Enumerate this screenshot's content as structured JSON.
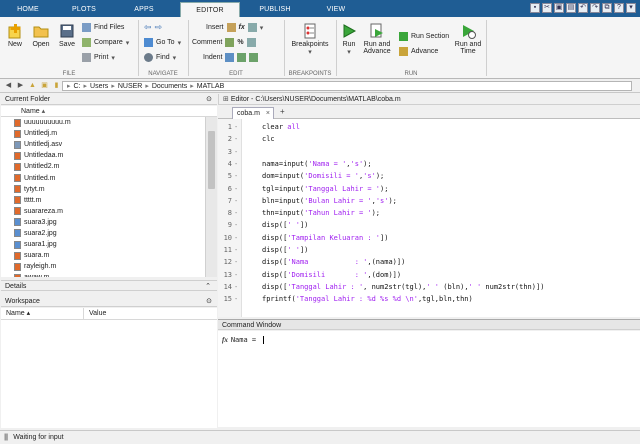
{
  "tabs": [
    "HOME",
    "PLOTS",
    "APPS",
    "EDITOR",
    "PUBLISH",
    "VIEW"
  ],
  "active_tab": "EDITOR",
  "ribbon": {
    "file": {
      "new": "New",
      "open": "Open",
      "save": "Save",
      "find_files": "Find Files",
      "compare": "Compare",
      "print": "Print",
      "label": "FILE"
    },
    "navigate": {
      "goto": "Go To",
      "find": "Find",
      "label": "NAVIGATE"
    },
    "edit": {
      "insert": "Insert",
      "comment": "Comment",
      "indent": "Indent",
      "fx": "fx",
      "label": "EDIT"
    },
    "breakpoints": {
      "button": "Breakpoints",
      "label": "BREAKPOINTS"
    },
    "run": {
      "run": "Run",
      "run_and_advance_1": "Run and",
      "run_and_advance_2": "Advance",
      "run_section": "Run Section",
      "advance": "Advance",
      "run_and_time_1": "Run and",
      "run_and_time_2": "Time",
      "label": "RUN"
    }
  },
  "address": {
    "crumbs": [
      "C:",
      "Users",
      "NUSER",
      "Documents",
      "MATLAB"
    ]
  },
  "current_folder": {
    "title": "Current Folder",
    "column": "Name",
    "files": [
      "uuuuuuuuuu.m",
      "Untitledj.m",
      "Untitledj.asv",
      "Untitledaa.m",
      "Untitled2.m",
      "Untitled.m",
      "tytyt.m",
      "ttttt.m",
      "suarareza.m",
      "suara3.jpg",
      "suara2.jpg",
      "suara1.jpg",
      "suara.m",
      "rayleigh.m",
      "awaw.m"
    ]
  },
  "details": {
    "title": "Details"
  },
  "workspace": {
    "title": "Workspace",
    "col_name": "Name",
    "col_value": "Value"
  },
  "editor": {
    "title": "Editor - C:\\Users\\NUSER\\Documents\\MATLAB\\coba.m",
    "tab": "coba.m",
    "add_tab": "+",
    "lines": [
      {
        "n": "1",
        "code": [
          {
            "t": "clear ",
            "c": "plain"
          },
          {
            "t": "all",
            "c": "str"
          }
        ]
      },
      {
        "n": "2",
        "code": [
          {
            "t": "clc",
            "c": "plain"
          }
        ]
      },
      {
        "n": "3",
        "code": []
      },
      {
        "n": "4",
        "code": [
          {
            "t": "nama=input(",
            "c": "plain"
          },
          {
            "t": "'Nama = '",
            "c": "str"
          },
          {
            "t": ",",
            "c": "plain"
          },
          {
            "t": "'s'",
            "c": "str"
          },
          {
            "t": ");",
            "c": "plain"
          }
        ]
      },
      {
        "n": "5",
        "code": [
          {
            "t": "dom=input(",
            "c": "plain"
          },
          {
            "t": "'Domisili = '",
            "c": "str"
          },
          {
            "t": ",",
            "c": "plain"
          },
          {
            "t": "'s'",
            "c": "str"
          },
          {
            "t": ");",
            "c": "plain"
          }
        ]
      },
      {
        "n": "6",
        "code": [
          {
            "t": "tgl=input(",
            "c": "plain"
          },
          {
            "t": "'Tanggal Lahir = '",
            "c": "str"
          },
          {
            "t": ");",
            "c": "plain"
          }
        ]
      },
      {
        "n": "7",
        "code": [
          {
            "t": "bln=input(",
            "c": "plain"
          },
          {
            "t": "'Bulan Lahir = '",
            "c": "str"
          },
          {
            "t": ",",
            "c": "plain"
          },
          {
            "t": "'s'",
            "c": "str"
          },
          {
            "t": ");",
            "c": "plain"
          }
        ]
      },
      {
        "n": "8",
        "code": [
          {
            "t": "thn=input(",
            "c": "plain"
          },
          {
            "t": "'Tahun Lahir = '",
            "c": "str"
          },
          {
            "t": ");",
            "c": "plain"
          }
        ]
      },
      {
        "n": "9",
        "code": [
          {
            "t": "disp([",
            "c": "plain"
          },
          {
            "t": "' '",
            "c": "str"
          },
          {
            "t": "])",
            "c": "plain"
          }
        ]
      },
      {
        "n": "10",
        "code": [
          {
            "t": "disp([",
            "c": "plain"
          },
          {
            "t": "'Tampilan Keluaran : '",
            "c": "str"
          },
          {
            "t": "])",
            "c": "plain"
          }
        ]
      },
      {
        "n": "11",
        "code": [
          {
            "t": "disp([",
            "c": "plain"
          },
          {
            "t": "' '",
            "c": "str"
          },
          {
            "t": "])",
            "c": "plain"
          }
        ]
      },
      {
        "n": "12",
        "code": [
          {
            "t": "disp([",
            "c": "plain"
          },
          {
            "t": "'Nama           : '",
            "c": "str"
          },
          {
            "t": ",(nama)])",
            "c": "plain"
          }
        ]
      },
      {
        "n": "13",
        "code": [
          {
            "t": "disp([",
            "c": "plain"
          },
          {
            "t": "'Domisili       : '",
            "c": "str"
          },
          {
            "t": ",(dom)])",
            "c": "plain"
          }
        ]
      },
      {
        "n": "14",
        "code": [
          {
            "t": "disp([",
            "c": "plain"
          },
          {
            "t": "'Tanggal Lahir : '",
            "c": "str"
          },
          {
            "t": ", num2str(tgl),",
            "c": "plain"
          },
          {
            "t": "' '",
            "c": "str"
          },
          {
            "t": " (bln),",
            "c": "plain"
          },
          {
            "t": "' '",
            "c": "str"
          },
          {
            "t": " num2str(thn)])",
            "c": "plain"
          }
        ]
      },
      {
        "n": "15",
        "code": [
          {
            "t": "fprintf(",
            "c": "plain"
          },
          {
            "t": "'Tanggal Lahir : %d %s %d \\n'",
            "c": "str"
          },
          {
            "t": ",tgl,bln,thn)",
            "c": "plain"
          }
        ]
      }
    ]
  },
  "command_window": {
    "title": "Command Window",
    "prompt_icon": "fx",
    "text": "Nama = "
  },
  "status": {
    "text": "Waiting for input"
  },
  "colors": {
    "tabstrip": "#1f5d94",
    "keyword": "#1a1aff",
    "string": "#a020f0"
  }
}
